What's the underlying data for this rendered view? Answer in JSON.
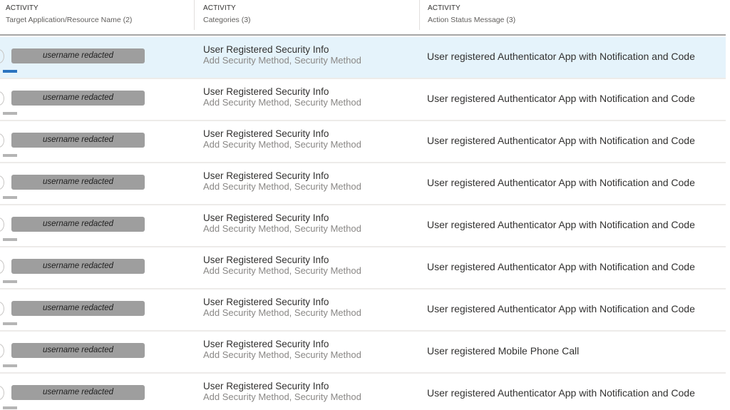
{
  "header": {
    "columns": [
      {
        "group": "ACTIVITY",
        "label": "Target Application/Resource Name (2)"
      },
      {
        "group": "ACTIVITY",
        "label": "Categories (3)"
      },
      {
        "group": "ACTIVITY",
        "label": "Action Status Message (3)"
      }
    ]
  },
  "rows": [
    {
      "user": "username redacted",
      "category_title": "User Registered Security Info",
      "category_sub": "Add Security Method, Security Method",
      "status": "User registered Authenticator App with Notification and Code",
      "selected": true
    },
    {
      "user": "username redacted",
      "category_title": "User Registered Security Info",
      "category_sub": "Add Security Method, Security Method",
      "status": "User registered Authenticator App with Notification and Code",
      "selected": false
    },
    {
      "user": "username redacted",
      "category_title": "User Registered Security Info",
      "category_sub": "Add Security Method, Security Method",
      "status": "User registered Authenticator App with Notification and Code",
      "selected": false
    },
    {
      "user": "username redacted",
      "category_title": "User Registered Security Info",
      "category_sub": "Add Security Method, Security Method",
      "status": "User registered Authenticator App with Notification and Code",
      "selected": false
    },
    {
      "user": "username redacted",
      "category_title": "User Registered Security Info",
      "category_sub": "Add Security Method, Security Method",
      "status": "User registered Authenticator App with Notification and Code",
      "selected": false
    },
    {
      "user": "username redacted",
      "category_title": "User Registered Security Info",
      "category_sub": "Add Security Method, Security Method",
      "status": "User registered Authenticator App with Notification and Code",
      "selected": false
    },
    {
      "user": "username redacted",
      "category_title": "User Registered Security Info",
      "category_sub": "Add Security Method, Security Method",
      "status": "User registered Authenticator App with Notification and Code",
      "selected": false
    },
    {
      "user": "username redacted",
      "category_title": "User Registered Security Info",
      "category_sub": "Add Security Method, Security Method",
      "status": "User registered Mobile Phone Call",
      "selected": false
    },
    {
      "user": "username redacted",
      "category_title": "User Registered Security Info",
      "category_sub": "Add Security Method, Security Method",
      "status": "User registered Authenticator App with Notification and Code",
      "selected": false
    }
  ]
}
